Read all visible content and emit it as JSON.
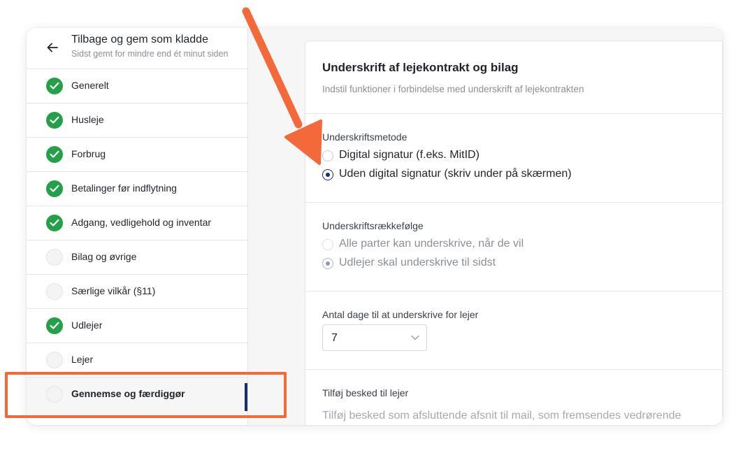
{
  "header": {
    "back_title": "Tilbage og gem som kladde",
    "back_subtitle": "Sidst gemt for mindre end ét minut siden"
  },
  "steps": [
    {
      "label": "Generelt",
      "status": "done"
    },
    {
      "label": "Husleje",
      "status": "done"
    },
    {
      "label": "Forbrug",
      "status": "done"
    },
    {
      "label": "Betalinger før indflytning",
      "status": "done"
    },
    {
      "label": "Adgang, vedligehold og inventar",
      "status": "done"
    },
    {
      "label": "Bilag og øvrige",
      "status": "todo"
    },
    {
      "label": "Særlige vilkår (§11)",
      "status": "todo"
    },
    {
      "label": "Udlejer",
      "status": "done"
    },
    {
      "label": "Lejer",
      "status": "todo"
    },
    {
      "label": "Gennemse og færdiggør",
      "status": "todo",
      "active": true
    }
  ],
  "panel": {
    "title": "Underskrift af lejekontrakt og bilag",
    "subtitle": "Indstil funktioner i forbindelse med underskrift af lejekontrakten",
    "signature_method": {
      "label": "Underskriftsmetode",
      "options": [
        {
          "label": "Digital signatur (f.eks. MitID)",
          "checked": false
        },
        {
          "label": "Uden digital signatur (skriv under på skærmen)",
          "checked": true
        }
      ]
    },
    "signature_order": {
      "label": "Underskriftsrækkefølge",
      "options": [
        {
          "label": "Alle parter kan underskrive, når de vil",
          "checked": false,
          "disabled": true
        },
        {
          "label": "Udlejer skal underskrive til sidst",
          "checked": true,
          "disabled": true
        }
      ]
    },
    "days_to_sign": {
      "label": "Antal dage til at underskrive for lejer",
      "value": "7"
    },
    "message": {
      "label": "Tilføj besked til lejer",
      "placeholder": "Tilføj besked som afsluttende afsnit til mail, som fremsendes vedrørende underskrift af lejekontrakt."
    }
  },
  "colors": {
    "done_green": "#24a148",
    "accent_navy": "#1c2d6b",
    "annotation_orange": "#f4693a"
  }
}
